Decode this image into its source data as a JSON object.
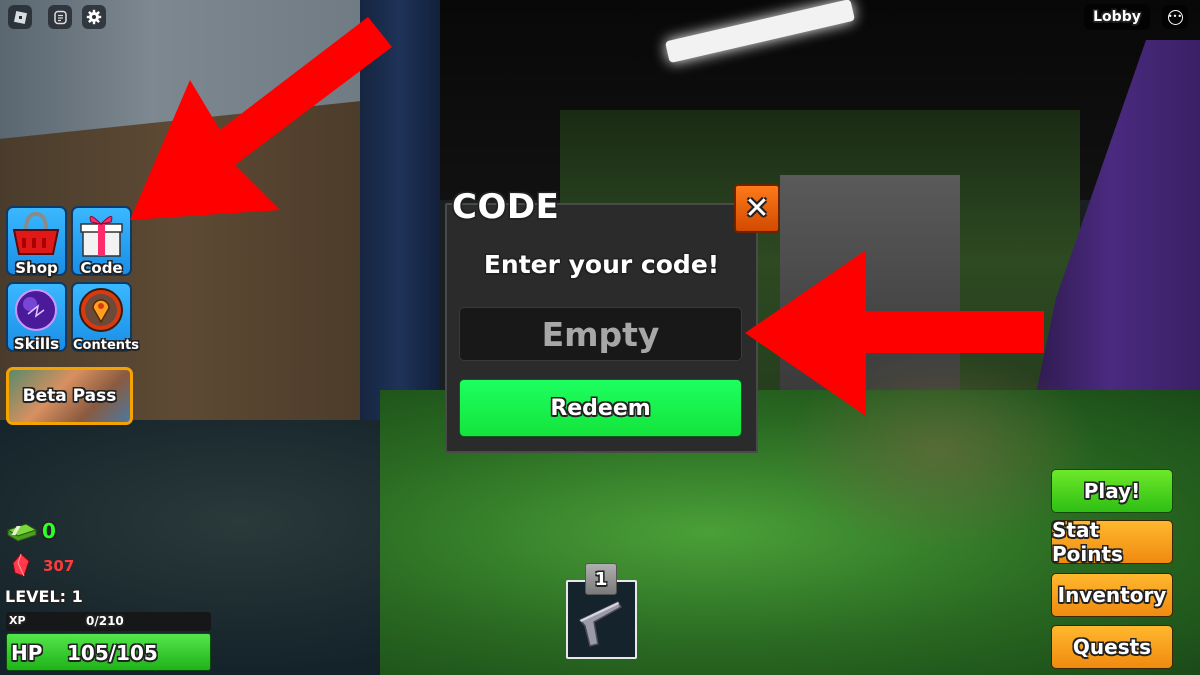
{
  "topbar": {
    "left_icons": [
      "roblox-logo-icon",
      "chat-icon",
      "settings-gear-icon"
    ],
    "server_label": "Lobby",
    "more_icon": "ellipsis-icon",
    "more_glyph": "•••"
  },
  "left_menu": {
    "items": [
      {
        "label": "Shop",
        "icon": "shopping-basket-icon"
      },
      {
        "label": "Code",
        "icon": "gift-box-icon"
      },
      {
        "label": "Skills",
        "icon": "purple-orb-icon"
      },
      {
        "label": "Contents",
        "icon": "location-pin-icon"
      }
    ],
    "banner_label": "Beta Pass"
  },
  "stats": {
    "cash_value": "0",
    "gems_value": "307",
    "level_label": "LEVEL: 1",
    "xp_label": "XP",
    "xp_value": "0/210",
    "xp_progress": 0,
    "hp_label": "HP",
    "hp_value": "105/105",
    "hp_progress": 1.0
  },
  "code_dialog": {
    "title": "CODE",
    "close_glyph": "✕",
    "prompt": "Enter your code!",
    "input_value": "",
    "input_placeholder": "Empty",
    "redeem_label": "Redeem"
  },
  "right_menu": {
    "play_label": "Play!",
    "stat_points_label": "Stat Points",
    "inventory_label": "Inventory",
    "quests_label": "Quests"
  },
  "hotbar": {
    "slot_number": "1",
    "slot_item": "pistol-icon"
  },
  "annotations": {
    "arrow_color": "#ff0000",
    "arrows": [
      "arrow-pointing-to-code-button",
      "arrow-pointing-to-code-input"
    ]
  }
}
